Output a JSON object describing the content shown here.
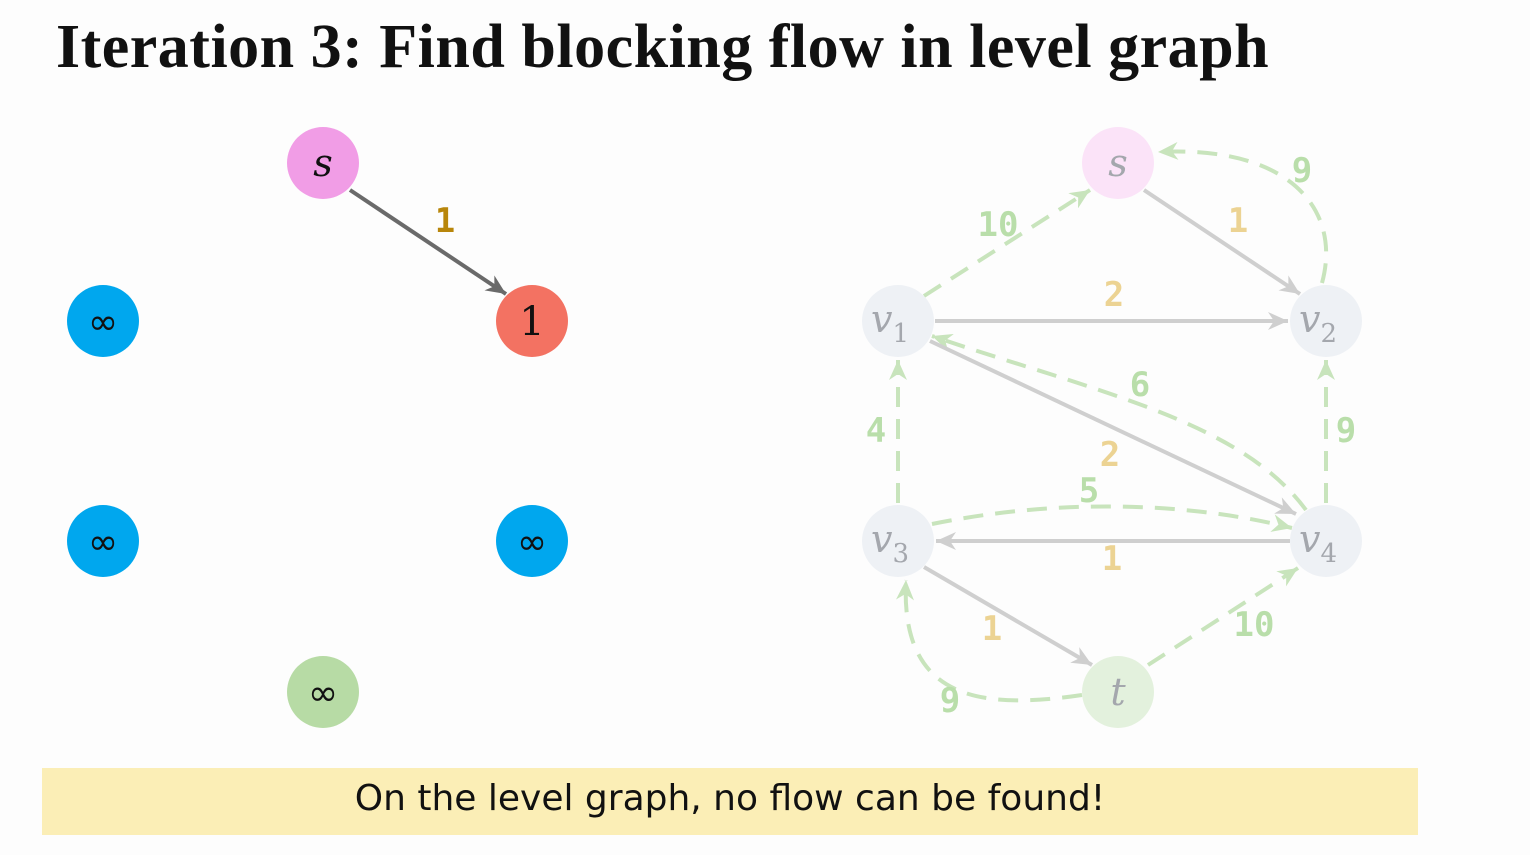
{
  "title": "Iteration 3: Find blocking flow in level graph",
  "caption": "On the level graph, no flow can be found!",
  "level_graph": {
    "nodes": [
      {
        "id": "s",
        "label": "s",
        "italic": true,
        "color": "#f19de6"
      },
      {
        "id": "v1",
        "label": "∞",
        "italic": false,
        "color": "#00a7ee"
      },
      {
        "id": "v2",
        "label": "1",
        "italic": false,
        "color": "#f37262"
      },
      {
        "id": "v3",
        "label": "∞",
        "italic": false,
        "color": "#00a7ee"
      },
      {
        "id": "v4",
        "label": "∞",
        "italic": false,
        "color": "#00a7ee"
      },
      {
        "id": "t",
        "label": "∞",
        "italic": false,
        "color": "#b7dba5"
      }
    ],
    "edges": [
      {
        "from": "s",
        "to": "v2",
        "label": "1"
      }
    ]
  },
  "residual_graph": {
    "nodes": [
      {
        "id": "s",
        "label": "s",
        "sub": ""
      },
      {
        "id": "v1",
        "label": "v",
        "sub": "1"
      },
      {
        "id": "v2",
        "label": "v",
        "sub": "2"
      },
      {
        "id": "v3",
        "label": "v",
        "sub": "3"
      },
      {
        "id": "v4",
        "label": "v",
        "sub": "4"
      },
      {
        "id": "t",
        "label": "t",
        "sub": ""
      }
    ],
    "forward_edges": [
      {
        "from": "s",
        "to": "v2",
        "label": "1"
      },
      {
        "from": "v1",
        "to": "v2",
        "label": "2"
      },
      {
        "from": "v1",
        "to": "v4",
        "label": "2"
      },
      {
        "from": "v4",
        "to": "v3",
        "label": "1"
      },
      {
        "from": "v3",
        "to": "t",
        "label": "1"
      }
    ],
    "backward_edges": [
      {
        "from": "v1",
        "to": "s",
        "label": "10"
      },
      {
        "from": "v2",
        "to": "s",
        "label": "9"
      },
      {
        "from": "v4",
        "to": "v1",
        "label": "6"
      },
      {
        "from": "v3",
        "to": "v1",
        "label": "4"
      },
      {
        "from": "v4",
        "to": "v2",
        "label": "9"
      },
      {
        "from": "v3",
        "to": "v4",
        "label": "5"
      },
      {
        "from": "t",
        "to": "v4",
        "label": "10"
      },
      {
        "from": "t",
        "to": "v3",
        "label": "9"
      }
    ]
  },
  "colors": {
    "level_edge": "#6a6a6a",
    "level_edge_label": "#b8860b",
    "residual_node_fill": "#eef1f5",
    "residual_s_fill": "#fbe3f8",
    "residual_t_fill": "#e3f1dd",
    "residual_node_text": "#a4a7ad",
    "forward_edge": "#cfcfcf",
    "forward_label": "#ecd393",
    "backward_edge": "#c8e4bc",
    "backward_label": "#b9deaa",
    "caption_bg": "#fbeeb6"
  }
}
